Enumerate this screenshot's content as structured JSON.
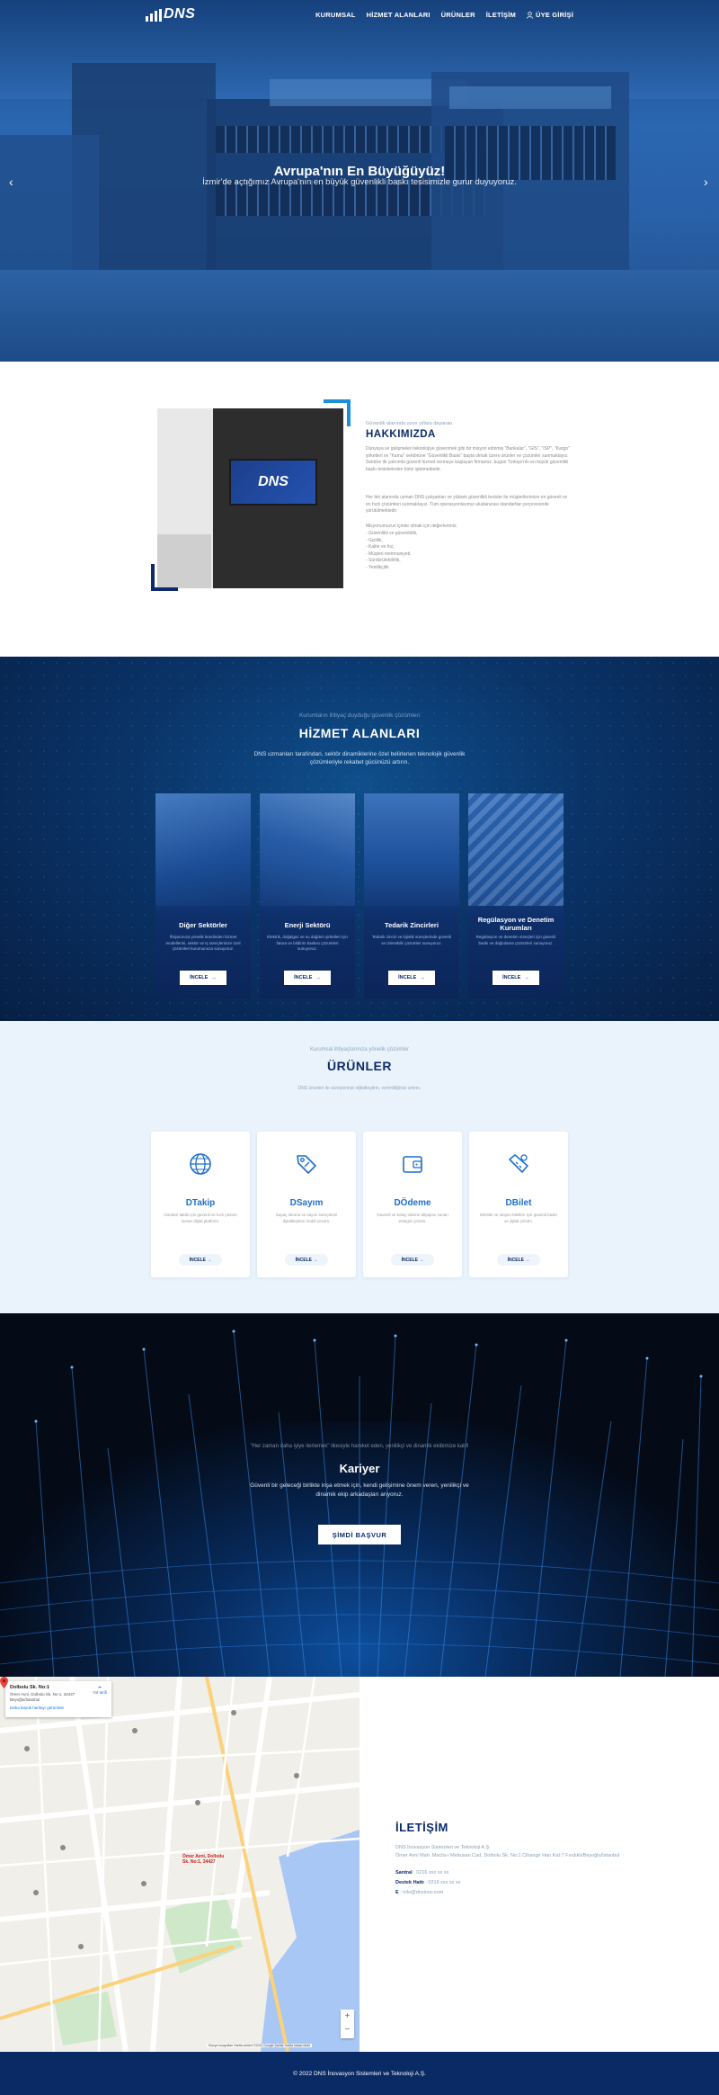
{
  "brand": {
    "logo_text": "DNS"
  },
  "nav": {
    "items": [
      {
        "label": "KURUMSAL"
      },
      {
        "label": "HİZMET ALANLARI"
      },
      {
        "label": "ÜRÜNLER"
      },
      {
        "label": "İLETİŞİM"
      }
    ],
    "login_label": "ÜYE GİRİŞİ"
  },
  "hero": {
    "title": "Avrupa'nın En Büyüğüyüz!",
    "subtitle": "İzmir'de açtığımız Avrupa'nın en büyük güvenlikli baskı tesisimizle gurur duyuyoruz.",
    "prev_icon": "chevron-left-icon",
    "next_icon": "chevron-right-icon"
  },
  "about": {
    "image_text": "DNS",
    "eyebrow": "Güvenlik alanında uzun yıllara dayanan",
    "title": "HAKKIMIZDA",
    "paragraphs": [
      "Dünyaya ve gelişmeleri teknolojiye güvenmek gibi bir misyon edinmiş \"Bankalar\", \"GİS\", \"ISP\", \"Kargo\" şirketleri ve \"Kamu\" sektörüne \"Güvenlikli Baskı\" başta olmak üzere ürünler ve çözümler sunmaktayız. Sektöre ilk yatırımla güvenli hizmet vermeye başlayan firmamız, bugün Türkiye'nin en büyük güvenlikli baskı tesislerinden birini işletmektedir.",
      "Her biri alanında uzman DNS çalışanları ve yüksek güvenlikli tesisler ile müşterilerimize en güvenli ve en hızlı çözümleri sunmaktayız. Tüm operasyonlarımız uluslararası standartlar çerçevesinde yürütülmektedir."
    ],
    "list_title": "Misyonumuzun içinde olmak için değerlerimiz;",
    "list": [
      "- Güvenlikli ve güvenilirlik,",
      "- Gizlilik,",
      "- Kalite ve hız,",
      "- Müşteri memnuniyeti,",
      "- Sürdürülebilirlik,",
      "- Yenilikçilik"
    ]
  },
  "services": {
    "eyebrow": "Kurumların ihtiyaç duyduğu güvenlik çözümleri",
    "title": "HİZMET ALANLARI",
    "description": "DNS uzmanları tarafından, sektör dinamiklerine özel belirlenen teknolojik güvenlik çözümleriyle rekabet gücünüzü artırın.",
    "cards": [
      {
        "title": "Diğer Sektörler",
        "text": "İhtiyacınıza yönelik kendinden hizmet modellerini, sektör ve iş süreçlerinize özel çözümleri kurumunuza sunuyoruz.",
        "button": "İNCELE"
      },
      {
        "title": "Enerji Sektörü",
        "text": "Elektrik, doğalgaz ve su dağıtım şirketleri için fatura ve bildirim baskısı çözümleri sunuyoruz.",
        "button": "İNCELE"
      },
      {
        "title": "Tedarik Zincirleri",
        "text": "Tedarik zinciri ve lojistik süreçlerinde güvenli ve izlenebilir çözümler sunuyoruz.",
        "button": "İNCELE"
      },
      {
        "title": "Regülasyon ve Denetim Kurumları",
        "text": "Regülasyon ve denetim süreçleri için güvenli baskı ve doğrulama çözümleri sunuyoruz.",
        "button": "İNCELE"
      }
    ]
  },
  "products": {
    "eyebrow": "Kurumsal ihtiyaçlarınıza yönelik çözümler",
    "title": "ÜRÜNLER",
    "description": "DNS ürünleri ile süreçlerinizi dijitalleştirin, verimliliğinizi artırın.",
    "cards": [
      {
        "title": "DTakip",
        "icon": "globe-icon",
        "text": "Gönderi takibi için güvenli ve hızlı çözüm sunan dijital platform.",
        "button": "İNCELE"
      },
      {
        "title": "DSayım",
        "icon": "tag-icon",
        "text": "Sayaç okuma ve sayım süreçlerini dijitalleştiren mobil çözüm.",
        "button": "İNCELE"
      },
      {
        "title": "DÖdeme",
        "icon": "wallet-icon",
        "text": "Güvenli ve kolay ödeme altyapısı sunan entegre çözüm.",
        "button": "İNCELE"
      },
      {
        "title": "DBilet",
        "icon": "ticket-icon",
        "text": "Etkinlik ve ulaşım biletleri için güvenli baskı ve dijital çözüm.",
        "button": "İNCELE"
      }
    ]
  },
  "career": {
    "eyebrow": "\"Her zaman daha iyiye ilerlemek\" ilkesiyle hareket eden, yenilikçi ve dinamik ekibimize katıl!",
    "title": "Kariyer",
    "description": "Güvenli bir geleceği birlikte inşa etmek için, kendi gelişimine önem veren, yenilikçi ve dinamik ekip arkadaşları arıyoruz.",
    "button": "ŞİMDİ BAŞVUR"
  },
  "map": {
    "place_title": "Dolbolu Sk. No:1",
    "place_address": "Ömer Avni, Dolbolu Sk. No:1, 34427 Beyoğlu/İstanbul",
    "larger_map": "Daha büyük haritayı görüntüle",
    "directions": "Yol tarifi",
    "pin_label": "Ömer Avni, Dolbolu Sk. No:1, 34427",
    "zoom_in": "+",
    "zoom_out": "−",
    "footer": "Klavye kısayolları  Harita verileri ©2022 Google  Şartlar  Harita hatası bildir"
  },
  "contact": {
    "title": "İLETİŞİM",
    "company": "DNS İnovasyon Sistemleri ve Teknoloji A.Ş.",
    "address": "Ömer Avni Mah. Meclis-i Mebusan Cad. Dolbolu Sk. No:1 Cihangir Han Kat:7 Fındıklı/Beyoğlu/İstanbul",
    "phone_label": "Santral",
    "phone": "0216 xxx xx xx",
    "hotline_label": "Destek Hattı",
    "hotline": "0216 xxx xx xx",
    "email_label": "E",
    "email": "info@dnsinov.com"
  },
  "footer": {
    "copyright": "© 2022 DNS İnovasyon Sistemleri ve Teknoloji A.Ş."
  },
  "colors": {
    "navy": "#0d2b6b",
    "accent": "#1f8ed9",
    "footer": "#0a2a66"
  }
}
